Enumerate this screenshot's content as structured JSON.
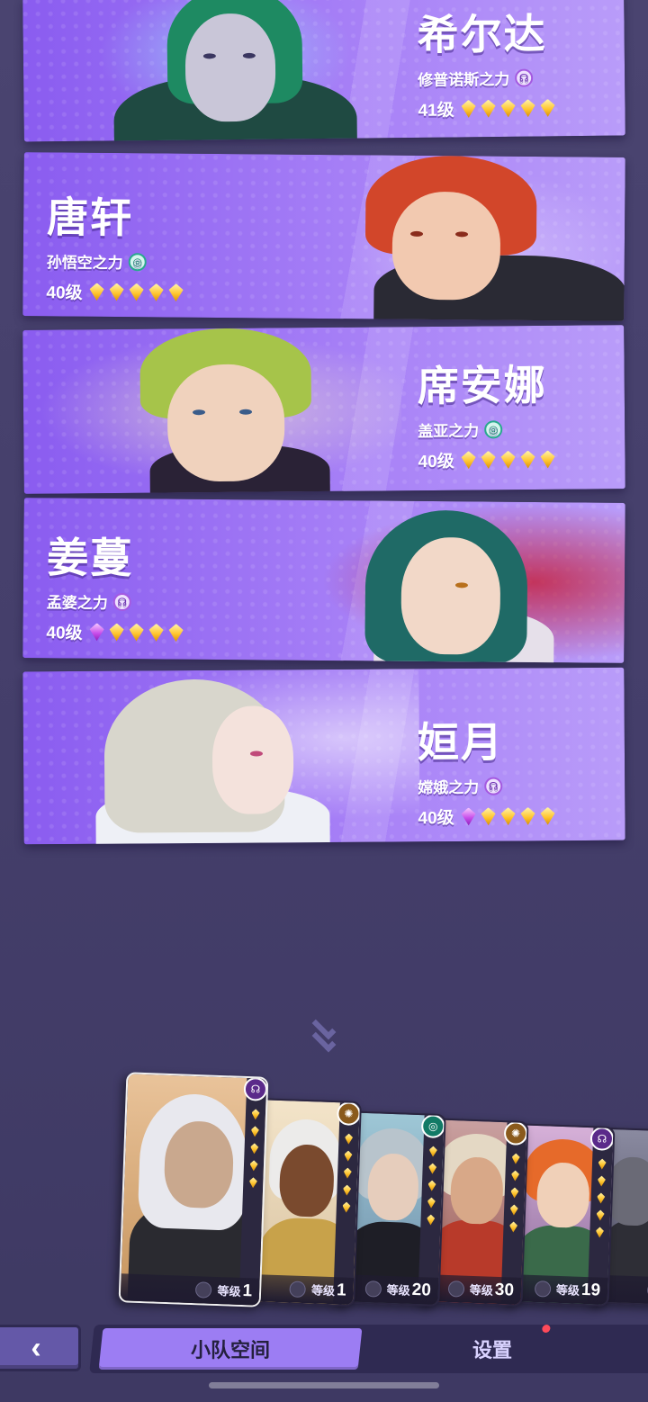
{
  "roster": [
    {
      "name": "希尔达",
      "power": "修普诺斯之力",
      "faction_icon": "myth",
      "level": "41级",
      "gems": [
        "gold",
        "gold",
        "gold",
        "gold",
        "gold"
      ],
      "side": "right"
    },
    {
      "name": "唐轩",
      "power": "孙悟空之力",
      "faction_icon": "wind",
      "level": "40级",
      "gems": [
        "gold",
        "gold",
        "gold",
        "gold",
        "gold"
      ],
      "side": "left"
    },
    {
      "name": "席安娜",
      "power": "盖亚之力",
      "faction_icon": "wind",
      "level": "40级",
      "gems": [
        "gold",
        "gold",
        "gold",
        "gold",
        "gold"
      ],
      "side": "right"
    },
    {
      "name": "姜蔓",
      "power": "孟婆之力",
      "faction_icon": "myth",
      "level": "40级",
      "gems": [
        "purple",
        "gold",
        "gold",
        "gold",
        "gold"
      ],
      "side": "left"
    },
    {
      "name": "姮月",
      "power": "嫦娥之力",
      "faction_icon": "myth",
      "level": "40级",
      "gems": [
        "purple",
        "gold",
        "gold",
        "gold",
        "gold"
      ],
      "side": "right"
    }
  ],
  "team": [
    {
      "level_label": "等级",
      "level": "1",
      "faction_icon": "myth"
    },
    {
      "level_label": "等级",
      "level": "1",
      "faction_icon": "sun"
    },
    {
      "level_label": "等级",
      "level": "20",
      "faction_icon": "wind"
    },
    {
      "level_label": "等级",
      "level": "30",
      "faction_icon": "sun"
    },
    {
      "level_label": "等级",
      "level": "19",
      "faction_icon": "myth"
    },
    {
      "level_label": "",
      "level": "",
      "faction_icon": ""
    }
  ],
  "nav": {
    "back_label": "‹",
    "tab_team_space": "小队空间",
    "tab_settings": "设置"
  },
  "colors": {
    "card_purple": "#9a72f4",
    "gem_gold": "#ffc52e",
    "gem_purple": "#c84dea",
    "active_tab": "#9c7df3",
    "notify_dot": "#ff4a5a"
  }
}
